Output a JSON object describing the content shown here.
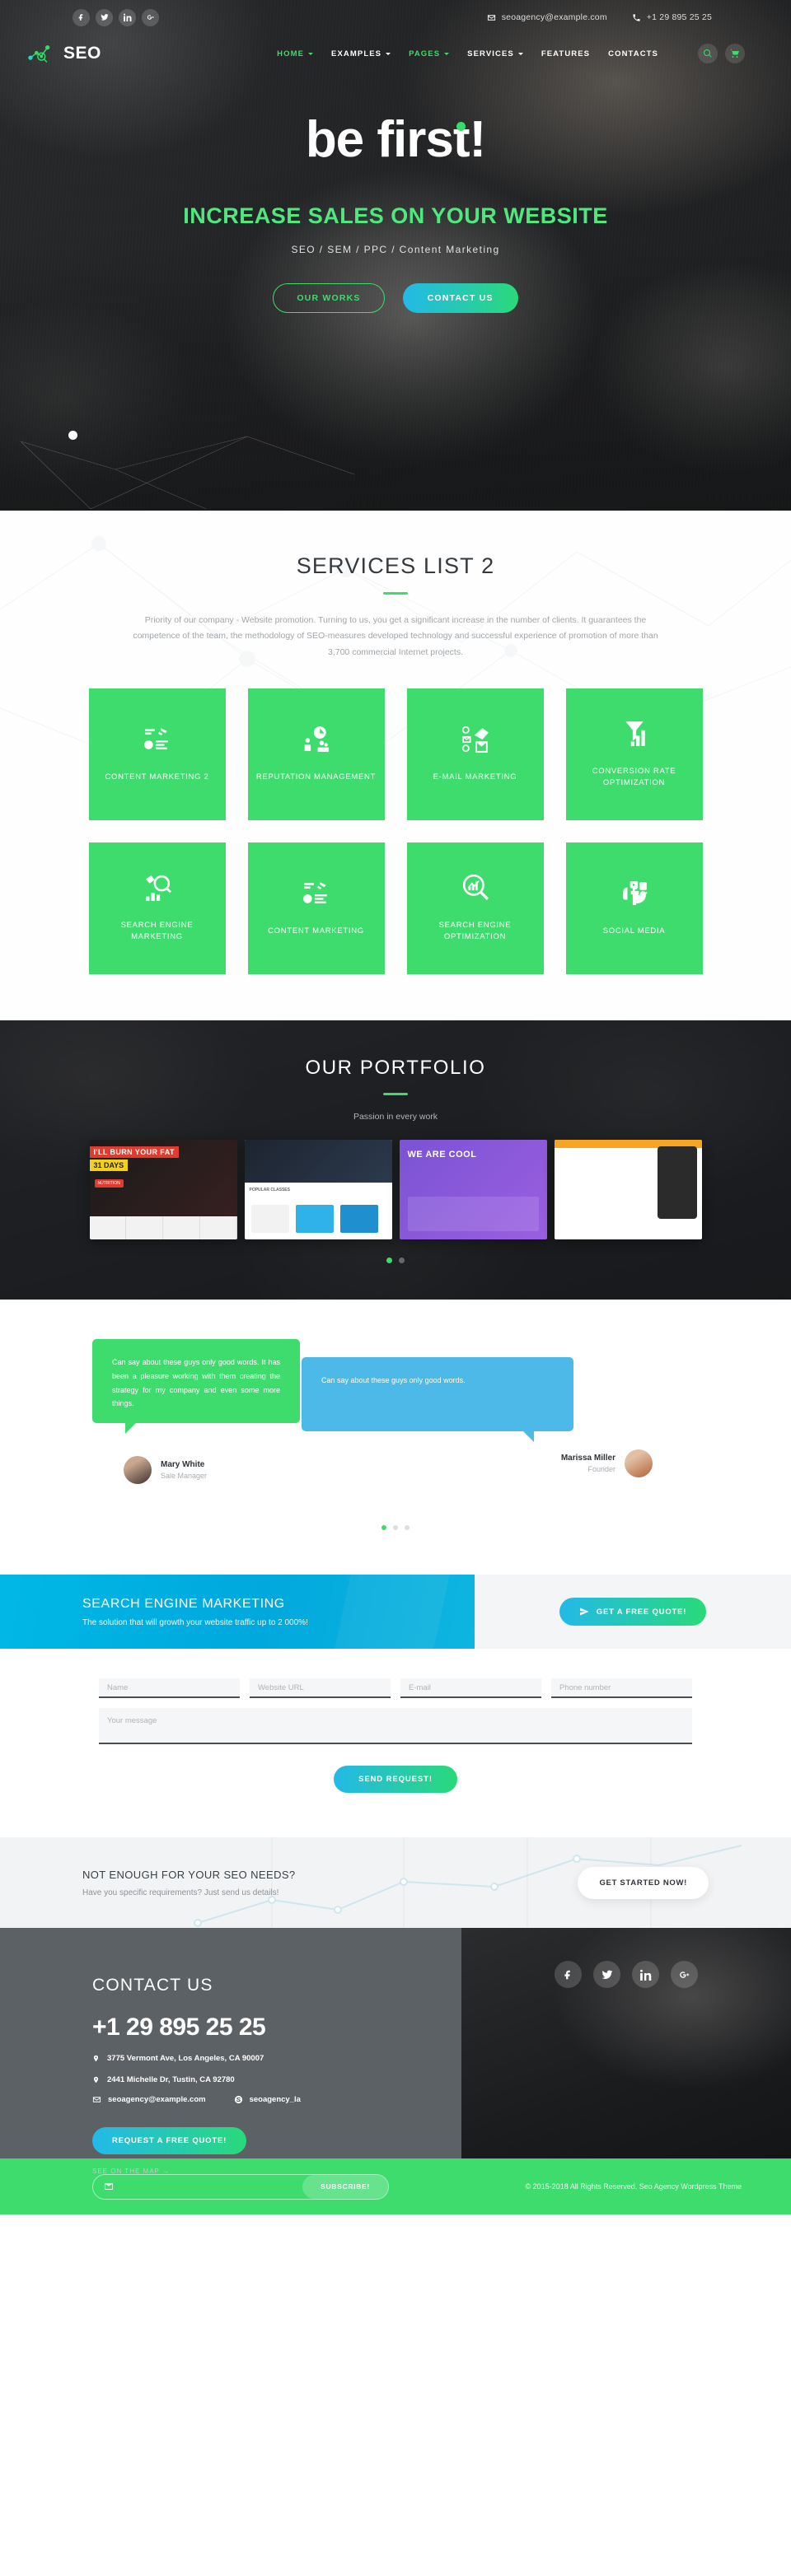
{
  "topbar": {
    "social": [
      {
        "name": "facebook-icon",
        "label": "f"
      },
      {
        "name": "twitter-icon",
        "label": "t"
      },
      {
        "name": "linkedin-icon",
        "label": "in"
      },
      {
        "name": "googleplus-icon",
        "label": "g+"
      }
    ],
    "email": "seoagency@example.com",
    "phone": "+1 29 895 25 25"
  },
  "nav": {
    "logo_text": "SEO",
    "items": [
      {
        "label": "HOME",
        "has_caret": true,
        "active": true
      },
      {
        "label": "EXAMPLES",
        "has_caret": true,
        "active": false
      },
      {
        "label": "PAGES",
        "has_caret": true,
        "active": true
      },
      {
        "label": "SERVICES",
        "has_caret": true,
        "active": false
      },
      {
        "label": "FEATURES",
        "has_caret": false,
        "active": false
      },
      {
        "label": "CONTACTS",
        "has_caret": false,
        "active": false
      }
    ]
  },
  "hero": {
    "title": "be first!",
    "subtitle": "INCREASE SALES ON YOUR WEBSITE",
    "tags": "SEO / SEM / PPC / Content Marketing",
    "btn_works": "OUR WORKS",
    "btn_contact": "CONTACT US"
  },
  "services": {
    "title": "SERVICES LIST 2",
    "description": "Priority of our company - Website promotion. Turning to us, you get a significant increase in the number of clients. It guarantees the competence of the team, the methodology of SEO-measures developed technology and successful experience of promotion of more than 3,700 commercial Internet projects.",
    "cards": [
      {
        "label": "CONTENT MARKETING 2",
        "icon": "content-marketing-icon"
      },
      {
        "label": "REPUTATION MANAGEMENT",
        "icon": "reputation-icon"
      },
      {
        "label": "E-MAIL MARKETING",
        "icon": "email-marketing-icon"
      },
      {
        "label": "CONVERSION RATE OPTIMIZATION",
        "icon": "conversion-rate-icon"
      },
      {
        "label": "SEARCH ENGINE MARKETING",
        "icon": "sem-icon"
      },
      {
        "label": "CONTENT MARKETING",
        "icon": "content-marketing-icon"
      },
      {
        "label": "SEARCH ENGINE OPTIMIZATION",
        "icon": "seo-icon"
      },
      {
        "label": "SOCIAL MEDIA",
        "icon": "social-media-icon"
      }
    ]
  },
  "portfolio": {
    "title": "OUR PORTFOLIO",
    "subtitle": "Passion in every work",
    "items": [
      {
        "name": "portfolio-fitness",
        "title": "I'LL BURN YOUR FAT",
        "badge": "31 DAYS",
        "tag": "NUTRITION"
      },
      {
        "name": "portfolio-gym",
        "title": "POPULAR CLASSES"
      },
      {
        "name": "portfolio-purple",
        "title": "WE ARE COOL"
      },
      {
        "name": "portfolio-mobile",
        "title": ""
      }
    ],
    "dots": [
      true,
      false
    ]
  },
  "testimonials": {
    "items": [
      {
        "text": "Can say about these guys only good words. It has been a pleasure working with them creating the strategy for my company and even some more things.",
        "author": "Mary White",
        "role": "Sale Manager",
        "color": "#3ddc6d"
      },
      {
        "text": "Can say about these guys only good words.",
        "author": "Marissa Miller",
        "role": "Founder",
        "color": "#4db9e8"
      }
    ],
    "dots": [
      true,
      false,
      false
    ]
  },
  "sem_banner": {
    "title": "SEARCH ENGINE MARKETING",
    "subtitle": "The solution that will growth your website traffic up to 2 000%!",
    "button": "GET A FREE QUOTE!"
  },
  "form": {
    "fields": [
      {
        "name": "name-field",
        "placeholder": "Name",
        "value": ""
      },
      {
        "name": "website-url-field",
        "placeholder": "Website URL",
        "value": ""
      },
      {
        "name": "email-field",
        "placeholder": "E-mail",
        "value": ""
      },
      {
        "name": "phone-field",
        "placeholder": "Phone number",
        "value": ""
      }
    ],
    "message_placeholder": "Your message",
    "submit": "SEND REQUEST!"
  },
  "cta": {
    "title": "NOT ENOUGH FOR YOUR SEO NEEDS?",
    "subtitle": "Have you specific requirements? Just send us details!",
    "button": "GET STARTED NOW!"
  },
  "footer": {
    "title": "CONTACT US",
    "phone": "+1 29 895 25 25",
    "address1": "3775 Vermont Ave, Los Angeles, CA 90007",
    "address2": "2441 Michelle Dr, Tustin, CA 92780",
    "email": "seoagency@example.com",
    "skype": "seoagency_la",
    "quote_button": "REQUEST A FREE QUOTE!",
    "map_link": "SEE ON THE MAP →",
    "social": [
      {
        "name": "facebook-icon"
      },
      {
        "name": "twitter-icon"
      },
      {
        "name": "linkedin-icon"
      },
      {
        "name": "googleplus-icon"
      }
    ]
  },
  "bottom": {
    "subscribe_placeholder": "",
    "subscribe_button": "SUBSCRIBE!",
    "copyright": "© 2015-2018 All Rights Reserved. Seo Agency Wordpress Theme"
  },
  "colors": {
    "brand_green": "#3ddc6d",
    "brand_blue": "#23b9e8",
    "dark": "#24262a",
    "footer_gray": "#5c6165"
  }
}
